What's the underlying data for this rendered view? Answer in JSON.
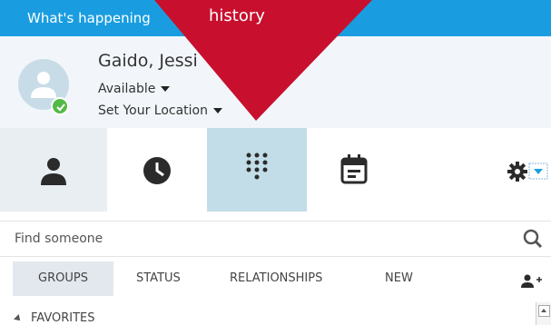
{
  "topbar": {
    "text": "What's happening"
  },
  "profile": {
    "name": "Gaido, Jessi",
    "availability": "Available",
    "location": "Set Your Location",
    "presence_color": "#54b948"
  },
  "tabs": [
    {
      "name": "contacts",
      "icon": "person-icon",
      "selected": true
    },
    {
      "name": "history",
      "icon": "clock-icon",
      "selected": false
    },
    {
      "name": "dialpad",
      "icon": "dialpad-icon",
      "selected": false,
      "highlighted": true
    },
    {
      "name": "meetings",
      "icon": "calendar-icon",
      "selected": false
    }
  ],
  "settings": {
    "icon": "gear-icon"
  },
  "search": {
    "placeholder": "Find someone",
    "icon": "search-icon"
  },
  "filters": [
    "GROUPS",
    "STATUS",
    "RELATIONSHIPS",
    "NEW"
  ],
  "favorites": {
    "label": "FAVORITES"
  },
  "callout": {
    "text": "history",
    "color": "#c8102e"
  },
  "colors": {
    "accent": "#1a9de0",
    "callout": "#c8102e"
  }
}
